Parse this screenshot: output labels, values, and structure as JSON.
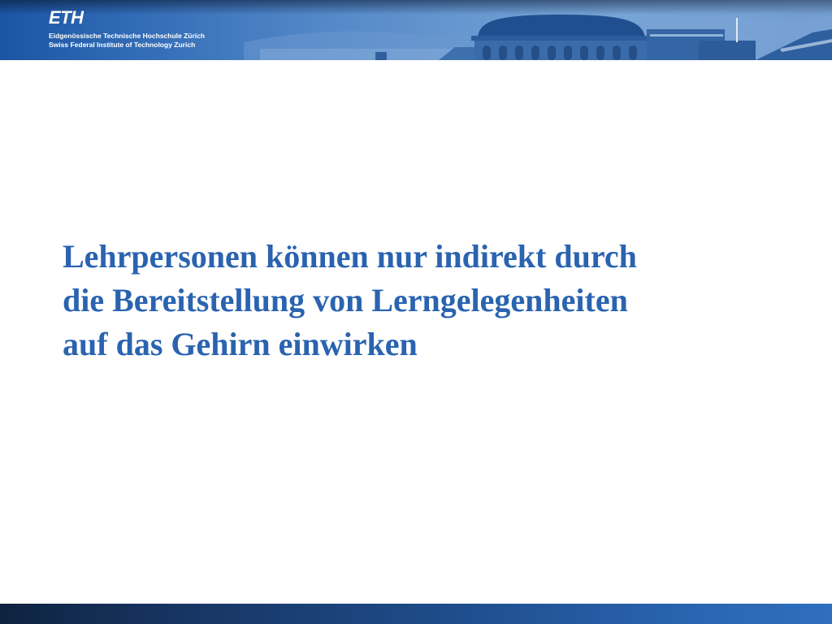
{
  "header": {
    "logo_text": "ETH",
    "institution_name_de": "Eidgenössische Technische Hochschule Zürich",
    "institution_name_en": "Swiss Federal Institute of Technology Zurich"
  },
  "slide": {
    "title_lines": [
      "Lehrpersonen können nur indirekt durch",
      "die Bereitstellung von Lerngelegenheiten",
      "auf das Gehirn einwirken"
    ]
  },
  "colors": {
    "title": "#2a63b0",
    "header_blue": "#2b67b4",
    "footer_dark": "#0f2340",
    "footer_light": "#2f6fbd"
  }
}
